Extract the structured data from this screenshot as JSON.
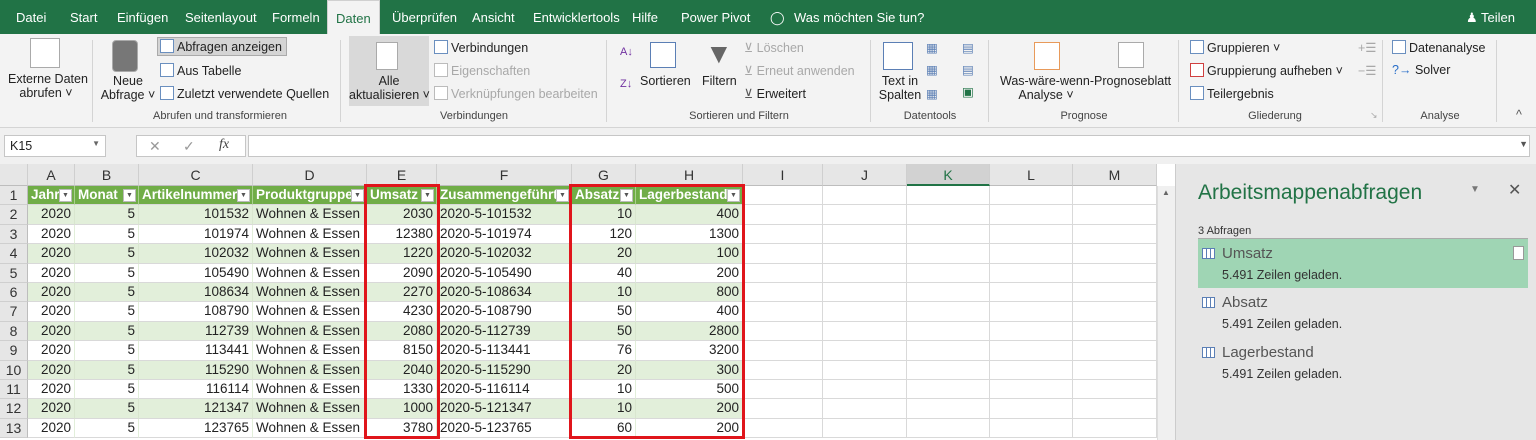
{
  "ribbon_tabs": [
    "Datei",
    "Start",
    "Einfügen",
    "Seitenlayout",
    "Formeln",
    "Daten",
    "Überprüfen",
    "Ansicht",
    "Entwicklertools",
    "Hilfe",
    "Power Pivot"
  ],
  "active_tab": "Daten",
  "tell_me": "Was möchten Sie tun?",
  "share": "Teilen",
  "ribbon": {
    "externe_daten": [
      "Externe Daten",
      "abrufen ˅"
    ],
    "neue_abfrage": [
      "Neue",
      "Abfrage ˅"
    ],
    "abfragen_anzeigen": "Abfragen anzeigen",
    "aus_tabelle": "Aus Tabelle",
    "zuletzt": "Zuletzt verwendete Quellen",
    "grp_abrufen": "Abrufen und transformieren",
    "alle_aktualisieren": [
      "Alle",
      "aktualisieren ˅"
    ],
    "verbindungen": "Verbindungen",
    "eigenschaften": "Eigenschaften",
    "verknuepfungen": "Verknüpfungen bearbeiten",
    "grp_verbindungen": "Verbindungen",
    "sortieren": "Sortieren",
    "filtern": "Filtern",
    "loeschen": "Löschen",
    "erneut": "Erneut anwenden",
    "erweitert": "Erweitert",
    "grp_sortieren": "Sortieren und Filtern",
    "text_in_spalten": [
      "Text in",
      "Spalten"
    ],
    "grp_datentools": "Datentools",
    "was_waere_wenn": [
      "Was-wäre-wenn-",
      "Analyse ˅"
    ],
    "prognoseblatt": "Prognoseblatt",
    "grp_prognose": "Prognose",
    "gruppieren": "Gruppieren",
    "gruppierung_aufheben": "Gruppierung aufheben",
    "teilergebnis": "Teilergebnis",
    "grp_gliederung": "Gliederung",
    "datenanalyse": "Datenanalyse",
    "solver": "Solver",
    "grp_analyse": "Analyse"
  },
  "name_box": "K15",
  "fx": "fx",
  "columns": [
    "A",
    "B",
    "C",
    "D",
    "E",
    "F",
    "G",
    "H",
    "I",
    "J",
    "K",
    "L",
    "M"
  ],
  "selected_column": "K",
  "table": {
    "headers": [
      "Jahr",
      "Monat",
      "Artikelnummer",
      "Produktgruppe",
      "Umsatz",
      "Zusammengeführt",
      "Absatz",
      "Lagerbestand"
    ],
    "rows": [
      [
        "2020",
        "5",
        "101532",
        "Wohnen & Essen",
        "2030",
        "2020-5-101532",
        "10",
        "400"
      ],
      [
        "2020",
        "5",
        "101974",
        "Wohnen & Essen",
        "12380",
        "2020-5-101974",
        "120",
        "1300"
      ],
      [
        "2020",
        "5",
        "102032",
        "Wohnen & Essen",
        "1220",
        "2020-5-102032",
        "20",
        "100"
      ],
      [
        "2020",
        "5",
        "105490",
        "Wohnen & Essen",
        "2090",
        "2020-5-105490",
        "40",
        "200"
      ],
      [
        "2020",
        "5",
        "108634",
        "Wohnen & Essen",
        "2270",
        "2020-5-108634",
        "10",
        "800"
      ],
      [
        "2020",
        "5",
        "108790",
        "Wohnen & Essen",
        "4230",
        "2020-5-108790",
        "50",
        "400"
      ],
      [
        "2020",
        "5",
        "112739",
        "Wohnen & Essen",
        "2080",
        "2020-5-112739",
        "50",
        "2800"
      ],
      [
        "2020",
        "5",
        "113441",
        "Wohnen & Essen",
        "8150",
        "2020-5-113441",
        "76",
        "3200"
      ],
      [
        "2020",
        "5",
        "115290",
        "Wohnen & Essen",
        "2040",
        "2020-5-115290",
        "20",
        "300"
      ],
      [
        "2020",
        "5",
        "116114",
        "Wohnen & Essen",
        "1330",
        "2020-5-116114",
        "10",
        "500"
      ],
      [
        "2020",
        "5",
        "121347",
        "Wohnen & Essen",
        "1000",
        "2020-5-121347",
        "10",
        "200"
      ],
      [
        "2020",
        "5",
        "123765",
        "Wohnen & Essen",
        "3780",
        "2020-5-123765",
        "60",
        "200"
      ]
    ]
  },
  "pane": {
    "title": "Arbeitsmappenabfragen",
    "count": "3 Abfragen",
    "queries": [
      {
        "name": "Umsatz",
        "status": "5.491 Zeilen geladen."
      },
      {
        "name": "Absatz",
        "status": "5.491 Zeilen geladen."
      },
      {
        "name": "Lagerbestand",
        "status": "5.491 Zeilen geladen."
      }
    ]
  },
  "colors": {
    "brand": "#217346",
    "table_header": "#70ad47",
    "band": "#e2efda",
    "highlight": "#e0151b",
    "selected_query": "#9fd5b4"
  }
}
